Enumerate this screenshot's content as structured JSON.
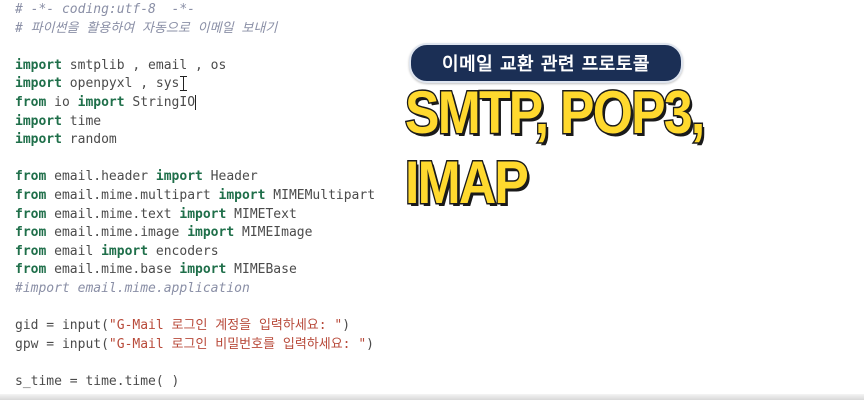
{
  "code": {
    "lines": [
      [
        {
          "t": "cm",
          "v": "# -*- coding:utf-8  -*-"
        }
      ],
      [
        {
          "t": "cm",
          "v": "# 파이썬을 활용하여 자동으로 이메일 보내기"
        }
      ],
      [],
      [
        {
          "t": "kw",
          "v": "import"
        },
        {
          "t": "op",
          "v": " smtplib , email , os"
        }
      ],
      [
        {
          "t": "kw",
          "v": "import"
        },
        {
          "t": "op",
          "v": " openpyxl , sys"
        }
      ],
      [
        {
          "t": "kw",
          "v": "from"
        },
        {
          "t": "op",
          "v": " io "
        },
        {
          "t": "kw",
          "v": "import"
        },
        {
          "t": "op",
          "v": " StringIO"
        }
      ],
      [
        {
          "t": "kw",
          "v": "import"
        },
        {
          "t": "op",
          "v": " time"
        }
      ],
      [
        {
          "t": "kw",
          "v": "import"
        },
        {
          "t": "op",
          "v": " random"
        }
      ],
      [],
      [
        {
          "t": "kw",
          "v": "from"
        },
        {
          "t": "op",
          "v": " email.header "
        },
        {
          "t": "kw",
          "v": "import"
        },
        {
          "t": "op",
          "v": " Header"
        }
      ],
      [
        {
          "t": "kw",
          "v": "from"
        },
        {
          "t": "op",
          "v": " email.mime.multipart "
        },
        {
          "t": "kw",
          "v": "import"
        },
        {
          "t": "op",
          "v": " MIMEMultipart"
        }
      ],
      [
        {
          "t": "kw",
          "v": "from"
        },
        {
          "t": "op",
          "v": " email.mime.text "
        },
        {
          "t": "kw",
          "v": "import"
        },
        {
          "t": "op",
          "v": " MIMEText"
        }
      ],
      [
        {
          "t": "kw",
          "v": "from"
        },
        {
          "t": "op",
          "v": " email.mime.image "
        },
        {
          "t": "kw",
          "v": "import"
        },
        {
          "t": "op",
          "v": " MIMEImage"
        }
      ],
      [
        {
          "t": "kw",
          "v": "from"
        },
        {
          "t": "op",
          "v": " email "
        },
        {
          "t": "kw",
          "v": "import"
        },
        {
          "t": "op",
          "v": " encoders"
        }
      ],
      [
        {
          "t": "kw",
          "v": "from"
        },
        {
          "t": "op",
          "v": " email.mime.base "
        },
        {
          "t": "kw",
          "v": "import"
        },
        {
          "t": "op",
          "v": " MIMEBase"
        }
      ],
      [
        {
          "t": "cm",
          "v": "#import email.mime.application"
        }
      ],
      [],
      [
        {
          "t": "op",
          "v": "gid = input("
        },
        {
          "t": "str",
          "v": "\"G-Mail 로그인 계정을 입력하세요: \""
        },
        {
          "t": "op",
          "v": ")"
        }
      ],
      [
        {
          "t": "op",
          "v": "gpw = input("
        },
        {
          "t": "str",
          "v": "\"G-Mail 로그인 비밀번호를 입력하세요: \""
        },
        {
          "t": "op",
          "v": ")"
        }
      ],
      [],
      [
        {
          "t": "op",
          "v": "s_time = time.time( )"
        }
      ]
    ]
  },
  "overlay": {
    "badge_text": "이메일 교환 관련 프로토콜",
    "headline_text": "SMTP, POP3, IMAP"
  }
}
